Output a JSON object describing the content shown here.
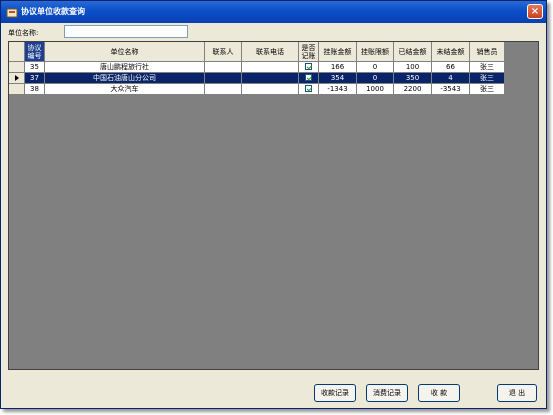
{
  "window": {
    "title": "协议单位收款查询",
    "close_glyph": "×"
  },
  "search": {
    "label": "单位名称:",
    "value": ""
  },
  "grid": {
    "columns": [
      "协议编号",
      "单位名称",
      "联系人",
      "联系电话",
      "是否记账",
      "挂账金额",
      "挂账限额",
      "已结金额",
      "未结金额",
      "销售员"
    ],
    "rows": [
      {
        "id": "35",
        "name": "唐山鹏程旅行社",
        "contact": "",
        "phone": "",
        "charged": true,
        "amount": "166",
        "limit": "0",
        "settled": "100",
        "unsettled": "66",
        "salesperson": "张三",
        "selected": false
      },
      {
        "id": "37",
        "name": "中国石油唐山分公司",
        "contact": "",
        "phone": "",
        "charged": true,
        "amount": "354",
        "limit": "0",
        "settled": "350",
        "unsettled": "4",
        "salesperson": "张三",
        "selected": true
      },
      {
        "id": "38",
        "name": "大众汽车",
        "contact": "",
        "phone": "",
        "charged": true,
        "amount": "-1343",
        "limit": "1000",
        "settled": "2200",
        "unsettled": "-3543",
        "salesperson": "张三",
        "selected": false
      }
    ]
  },
  "buttons": {
    "receipt_record": "收款记录",
    "consume_record": "消费记录",
    "collect": "收 款",
    "exit": "退 出"
  },
  "colors": {
    "titlebar": "#0a4fc9",
    "selected_row": "#0a246a",
    "grid_background": "#808080",
    "window_background": "#ece9d8"
  }
}
